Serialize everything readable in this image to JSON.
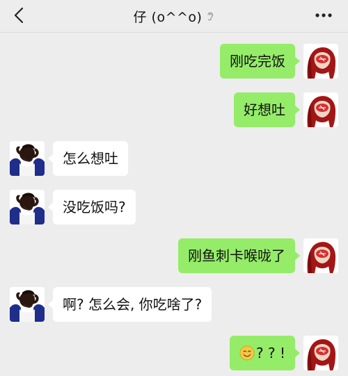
{
  "header": {
    "title": "仔 (o^^o)",
    "back_icon": "chevron-left-icon",
    "ear_icon": "ear-icon",
    "more_icon": "more-dots-icon"
  },
  "messages": [
    {
      "side": "right",
      "text": "刚吃完饭"
    },
    {
      "side": "right",
      "text": "好想吐"
    },
    {
      "side": "left",
      "text": "怎么想吐"
    },
    {
      "side": "left",
      "text": "没吃饭吗?"
    },
    {
      "side": "right",
      "text": "刚鱼刺卡喉咙了"
    },
    {
      "side": "left",
      "text": "啊? 怎么会, 你吃啥了?"
    },
    {
      "side": "right",
      "text": "? ? !",
      "emoji": "smile-emoji-icon"
    }
  ],
  "colors": {
    "background": "#ededed",
    "sent_bubble": "#95ec69",
    "received_bubble": "#ffffff"
  }
}
